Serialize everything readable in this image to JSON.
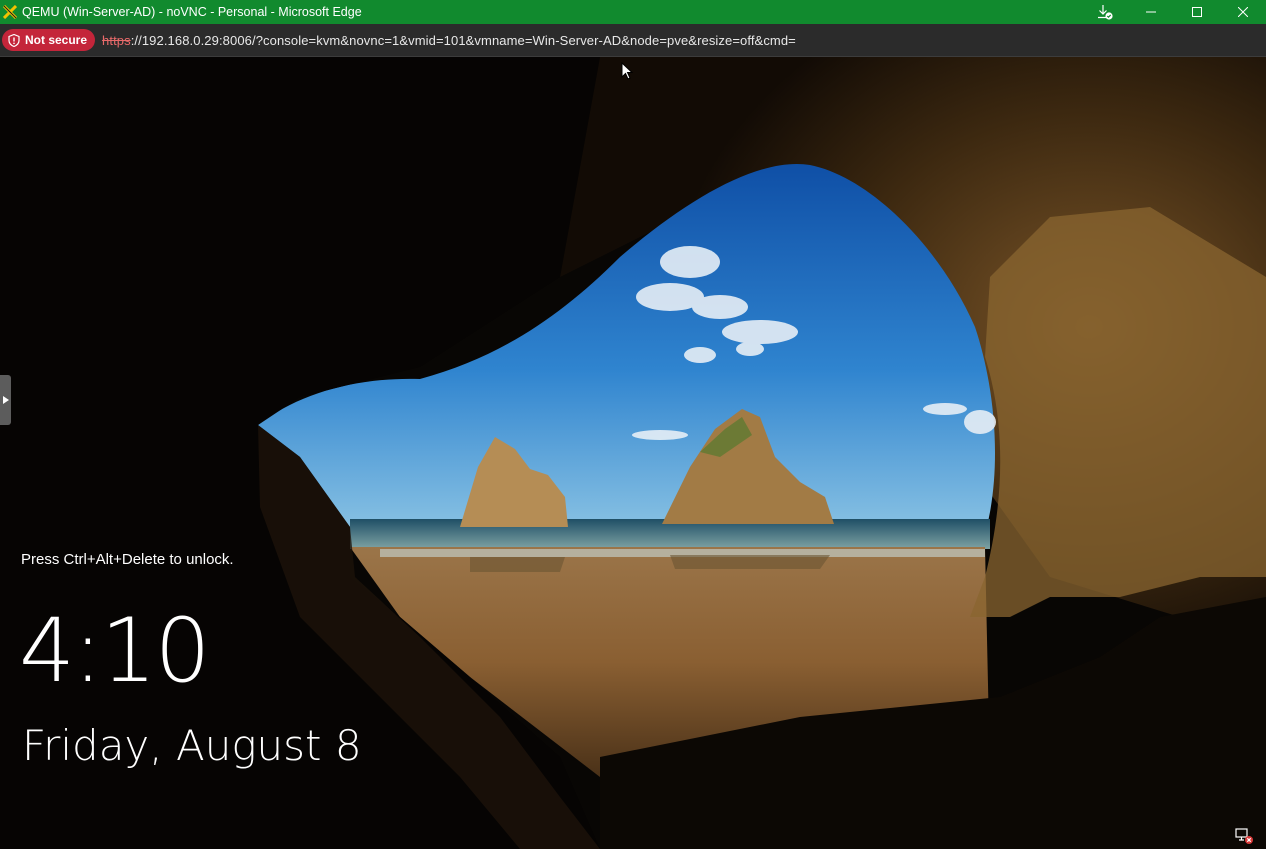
{
  "window": {
    "title": "QEMU (Win-Server-AD) - noVNC - Personal - Microsoft Edge",
    "title_bar_color": "#118a2e"
  },
  "addressbar": {
    "security_label": "Not secure",
    "security_color": "#c4253a",
    "url_scheme": "https",
    "url_rest": "://192.168.0.29:8006/?console=kvm&novnc=1&vmid=101&vmname=Win-Server-AD&node=pve&resize=off&cmd="
  },
  "lockscreen": {
    "unlock_hint": "Press Ctrl+Alt+Delete to unlock.",
    "time": "4:10",
    "date": "Friday, August 8"
  },
  "icons": {
    "app": "qemu-logo-icon",
    "download": "download-icon",
    "minimize": "minimize-icon",
    "maximize": "maximize-icon",
    "close": "close-icon",
    "security": "shield-warning-icon",
    "sidebar": "expand-arrow-icon",
    "network": "network-disconnected-icon"
  }
}
